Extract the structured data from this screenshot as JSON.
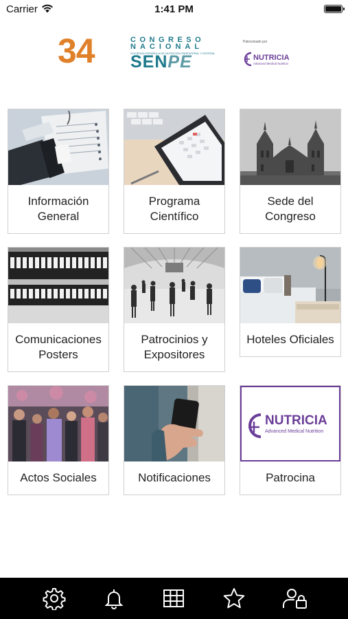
{
  "status_bar": {
    "carrier": "Carrier",
    "time": "1:41 PM"
  },
  "header": {
    "number": "34",
    "congreso": "CONGRESO",
    "nacional": "NACIONAL",
    "subtitle": "SOCIEDAD ESPAÑOLA DE NUTRICIÓN PARENTERAL Y ENTERAL",
    "senpe_a": "SEN",
    "senpe_b": "PE",
    "sponsor_label": "Patrocinado por",
    "sponsor_name": "NUTRICIA",
    "sponsor_tagline": "Advanced Medical Nutrition"
  },
  "menu": {
    "items": [
      {
        "label": "Información General",
        "image": "documents-photo"
      },
      {
        "label": "Programa Científico",
        "image": "tablet-calendar-photo"
      },
      {
        "label": "Sede del Congreso",
        "image": "cathedral-photo"
      },
      {
        "label": "Comunicaciones Posters",
        "image": "binders-photo"
      },
      {
        "label": "Patrocinios y Expositores",
        "image": "exhibition-hall-photo"
      },
      {
        "label": "Hoteles Oficiales",
        "image": "hotel-room-photo"
      },
      {
        "label": "Actos Sociales",
        "image": "crowd-photo"
      },
      {
        "label": "Notificaciones",
        "image": "phone-hand-photo"
      },
      {
        "label": "Patrocina",
        "image": "nutricia-logo"
      }
    ]
  },
  "patrocina_logo": {
    "name": "NUTRICIA",
    "tagline": "Advanced Medical Nutrition"
  },
  "tabbar": {
    "icons": [
      "gear-icon",
      "bell-icon",
      "grid-icon",
      "star-icon",
      "user-lock-icon"
    ]
  },
  "colors": {
    "orange": "#e0812a",
    "teal": "#1e7a8c",
    "purple": "#6a3d98",
    "tabbar": "#000000"
  }
}
